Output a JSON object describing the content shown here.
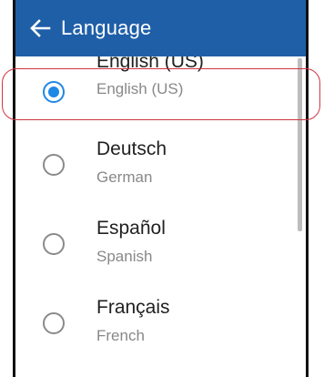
{
  "header": {
    "title": "Language",
    "back_icon": "arrow-left-icon",
    "background": "#1f5fa8"
  },
  "languages": [
    {
      "name": "English (US)",
      "subtitle": "English (US)",
      "selected": true
    },
    {
      "name": "Deutsch",
      "subtitle": "German",
      "selected": false
    },
    {
      "name": "Español",
      "subtitle": "Spanish",
      "selected": false
    },
    {
      "name": "Français",
      "subtitle": "French",
      "selected": false
    }
  ],
  "colors": {
    "accent": "#1e88e5",
    "highlight_outline": "#d0343f"
  }
}
